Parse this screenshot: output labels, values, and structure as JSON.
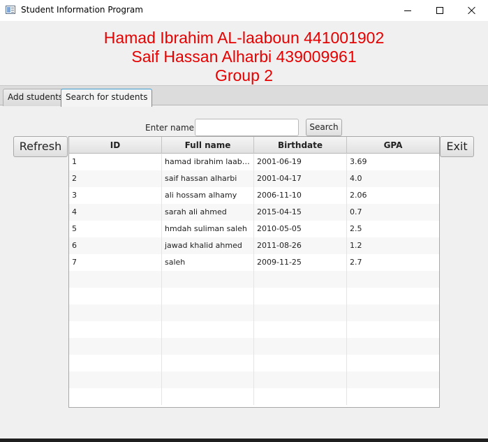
{
  "window": {
    "title": "Student Information Program",
    "icon": "app-window-icon",
    "controls": [
      "minimize",
      "maximize",
      "close"
    ]
  },
  "header": {
    "line1": "Hamad Ibrahim AL-laaboun 441001902",
    "line2": "Saif Hassan Alharbi 439009961",
    "line3": "Group 2",
    "color": "#e60000"
  },
  "tabs": [
    {
      "label": "Add students",
      "selected": false
    },
    {
      "label": "Search for students",
      "selected": true
    }
  ],
  "search": {
    "label": "Enter name",
    "value": "",
    "placeholder": "",
    "button_label": "Search"
  },
  "buttons": {
    "refresh": "Refresh",
    "exit": "Exit"
  },
  "table": {
    "columns": [
      "ID",
      "Full name",
      "Birthdate",
      "GPA"
    ],
    "rows": [
      [
        "1",
        "hamad ibrahim laaboun",
        "2001-06-19",
        "3.69"
      ],
      [
        "2",
        "saif hassan alharbi",
        "2001-04-17",
        "4.0"
      ],
      [
        "3",
        "ali hossam alhamy",
        "2006-11-10",
        "2.06"
      ],
      [
        "4",
        "sarah ali ahmed",
        "2015-04-15",
        "0.7"
      ],
      [
        "5",
        "hmdah suliman saleh",
        "2010-05-05",
        "2.5"
      ],
      [
        "6",
        "jawad khalid ahmed",
        "2011-08-26",
        "1.2"
      ],
      [
        "7",
        "saleh",
        "2009-11-25",
        "2.7"
      ]
    ],
    "empty_rows": 8
  }
}
